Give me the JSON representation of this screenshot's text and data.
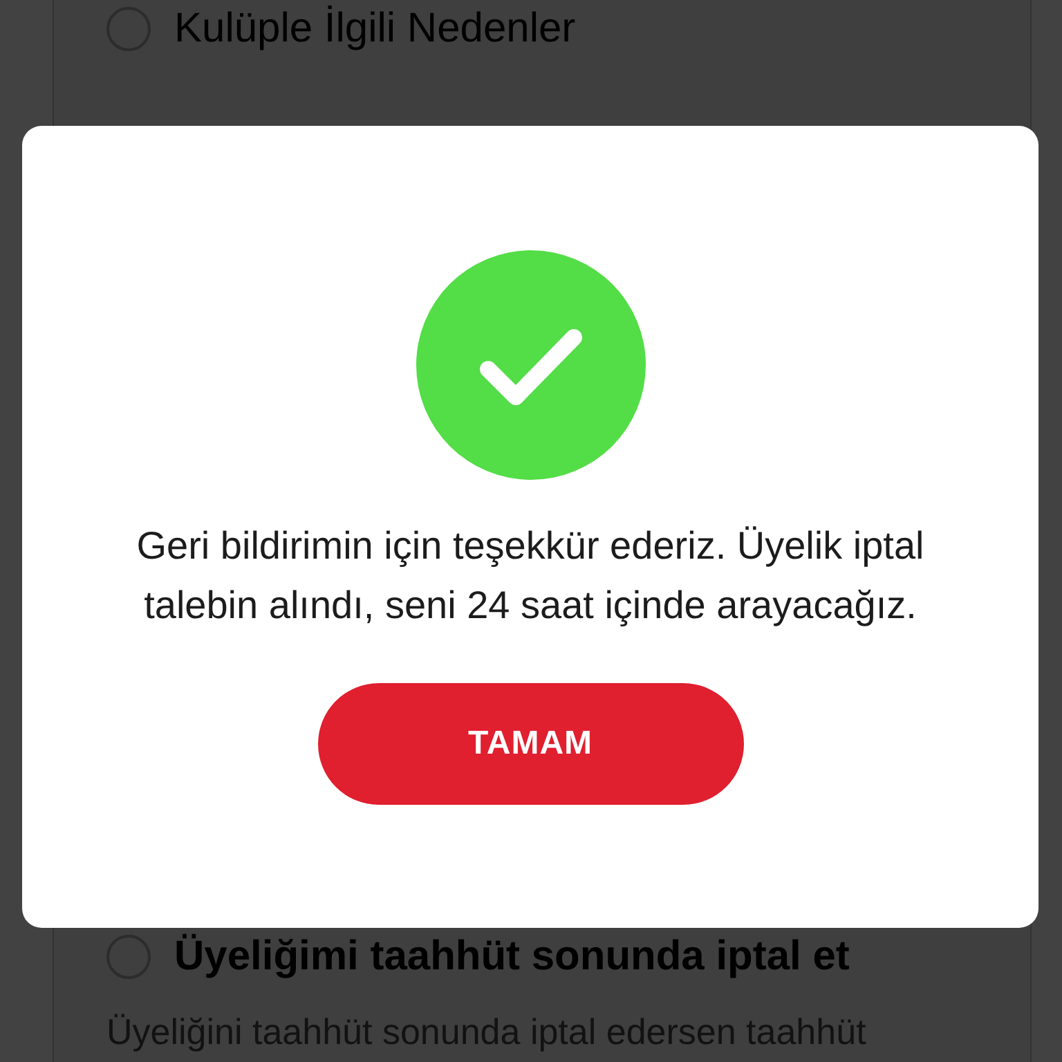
{
  "background_page": {
    "options": [
      {
        "kind": "reason",
        "label": "Kulüple İlgili Nedenler",
        "selected": false
      },
      {
        "kind": "plan",
        "label": "Üyeliğimi taahhüt sonunda iptal et",
        "description": "Üyeliğini taahhüt sonunda iptal edersen taahhüt",
        "selected": false
      }
    ]
  },
  "dialog": {
    "message": "Geri bildirimin için teşekkür ederiz. Üyelik iptal talebin alındı, seni 24 saat içinde arayacağız.",
    "button": "TAMAM"
  }
}
